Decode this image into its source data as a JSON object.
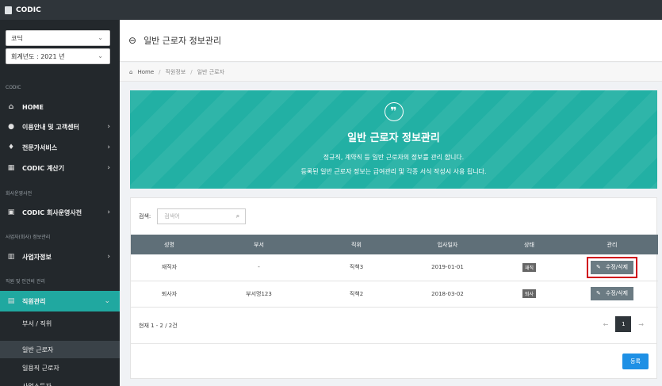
{
  "app": {
    "title": "CODIC"
  },
  "sidebar": {
    "font_select": "코딕",
    "year_select": "회계년도 : 2021 년",
    "sections": {
      "codic": "CODIC",
      "company": "회사운영사전",
      "business": "사업자(회사) 정보관리",
      "staff": "직원 및 인건비 관리"
    },
    "items": {
      "home": "HOME",
      "guide": "이용안내 및 고객센터",
      "expert": "전문가서비스",
      "calc": "CODIC 계산기",
      "company_dict": "CODIC 회사운영사전",
      "business_info": "사업자정보",
      "staff_mgmt": "직원관리"
    },
    "sub": {
      "dept": "부서 / 직위",
      "regular": "일반 근로자",
      "daily": "일용직 근로자",
      "more": "사업소득자"
    }
  },
  "header": {
    "title": "일반 근로자 정보관리"
  },
  "breadcrumb": {
    "home": "Home",
    "level1": "직원정보",
    "level2": "일반 근로자"
  },
  "banner": {
    "quote_glyph": "❞",
    "title": "일반 근로자 정보관리",
    "desc1": "정규직, 계약직 등 일반 근로자의 정보를 관리 합니다.",
    "desc2": "등록된 일반 근로자 정보는 급여관리 및 각종 서식 작성시 사용 됩니다."
  },
  "search": {
    "label": "검색:",
    "placeholder": "검색어"
  },
  "table": {
    "headers": [
      "성명",
      "부서",
      "직위",
      "입사일자",
      "상태",
      "관리"
    ],
    "rows": [
      {
        "name": "재직자",
        "dept": "-",
        "position": "직책3",
        "join_date": "2019-01-01",
        "status": "재직",
        "action": "수정/삭제"
      },
      {
        "name": "퇴사자",
        "dept": "부서명123",
        "position": "직책2",
        "join_date": "2018-03-02",
        "status": "퇴사",
        "action": "수정/삭제"
      }
    ]
  },
  "footer": {
    "count": "현재 1 - 2 / 2건"
  },
  "pagination": {
    "prev": "←",
    "current": "1",
    "next": "→"
  },
  "register_button": "등록",
  "colors": {
    "accent": "#22b0a4",
    "sidebar": "#23282c",
    "primary_button": "#1e90e5",
    "highlight": "#d0021b"
  }
}
